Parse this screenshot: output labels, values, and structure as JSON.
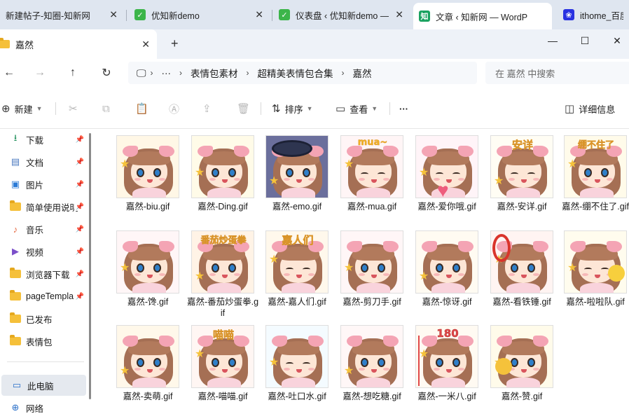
{
  "browser": {
    "tabs": [
      {
        "title": "新建帖子-知圈-知新网",
        "active": false
      },
      {
        "title": "优知新demo",
        "active": false
      },
      {
        "title": "仪表盘 ‹ 优知新demo —",
        "active": false
      },
      {
        "title": "文章 ‹ 知新网 — WordP",
        "active": true
      },
      {
        "title": "ithome_百度搜",
        "active": false
      }
    ],
    "favicon_text": "知",
    "new_tab_glyph": "+"
  },
  "explorer": {
    "window_tab_title": "嘉然",
    "breadcrumb": [
      "表情包素材",
      "超精美表情包合集",
      "嘉然"
    ],
    "breadcrumb_more": "···",
    "search_placeholder": "在 嘉然 中搜索",
    "toolbar": {
      "new_label": "新建",
      "sort_label": "排序",
      "view_label": "查看",
      "more_label": "···",
      "details_label": "详细信息"
    },
    "sidebar": {
      "items": [
        {
          "label": "下载",
          "icon": "download-icon",
          "pinned": true
        },
        {
          "label": "文档",
          "icon": "document-icon",
          "pinned": true
        },
        {
          "label": "图片",
          "icon": "picture-icon",
          "pinned": true
        },
        {
          "label": "简单使用说明",
          "icon": "folder-icon",
          "pinned": true
        },
        {
          "label": "音乐",
          "icon": "music-icon",
          "pinned": true
        },
        {
          "label": "视频",
          "icon": "video-icon",
          "pinned": true
        },
        {
          "label": "浏览器下载",
          "icon": "folder-icon",
          "pinned": true
        },
        {
          "label": "pageTempla",
          "icon": "folder-icon",
          "pinned": true
        },
        {
          "label": "已发布",
          "icon": "folder-icon",
          "pinned": false
        },
        {
          "label": "表情包",
          "icon": "folder-icon",
          "pinned": false
        }
      ],
      "this_pc": "此电脑",
      "network": "网络"
    },
    "files": [
      {
        "name": "嘉然-biu.gif",
        "deco": "",
        "eyes": "open"
      },
      {
        "name": "嘉然-Ding.gif",
        "deco": "",
        "eyes": "open"
      },
      {
        "name": "嘉然-emo.gif",
        "deco": "",
        "eyes": "open"
      },
      {
        "name": "嘉然-mua.gif",
        "deco": "mua~",
        "eyes": "closed"
      },
      {
        "name": "嘉然-爱你哦.gif",
        "deco": "",
        "eyes": "closed"
      },
      {
        "name": "嘉然-安详.gif",
        "deco": "安详",
        "eyes": "closed"
      },
      {
        "name": "嘉然-绷不住了.gif",
        "deco": "绷不住了",
        "eyes": "open"
      },
      {
        "name": "嘉然-馋.gif",
        "deco": "",
        "eyes": "open"
      },
      {
        "name": "嘉然-番茄炒蛋拳.gif",
        "deco": "番茄炒蛋拳",
        "eyes": "open"
      },
      {
        "name": "嘉然-嘉人们.gif",
        "deco": "嘉人们",
        "eyes": "closed"
      },
      {
        "name": "嘉然-剪刀手.gif",
        "deco": "",
        "eyes": "open"
      },
      {
        "name": "嘉然-惊讶.gif",
        "deco": "",
        "eyes": "open"
      },
      {
        "name": "嘉然-看铁锤.gif",
        "deco": "",
        "eyes": "open"
      },
      {
        "name": "嘉然-啦啦队.gif",
        "deco": "",
        "eyes": "closed"
      },
      {
        "name": "嘉然-卖萌.gif",
        "deco": "",
        "eyes": "open"
      },
      {
        "name": "嘉然-喵喵.gif",
        "deco": "喵喵",
        "eyes": "open"
      },
      {
        "name": "嘉然-吐口水.gif",
        "deco": "",
        "eyes": "closed"
      },
      {
        "name": "嘉然-想吃糖.gif",
        "deco": "",
        "eyes": "open"
      },
      {
        "name": "嘉然-一米八.gif",
        "deco": "180",
        "eyes": "open"
      },
      {
        "name": "嘉然-赞.gif",
        "deco": "",
        "eyes": "open"
      }
    ]
  },
  "colors": {
    "tabbar_bg": "#dfe6f0",
    "folder": "#f5c03a",
    "hair": "#a56f54",
    "bow": "#f4a4b4",
    "deco_yellow": "#f3b425"
  }
}
